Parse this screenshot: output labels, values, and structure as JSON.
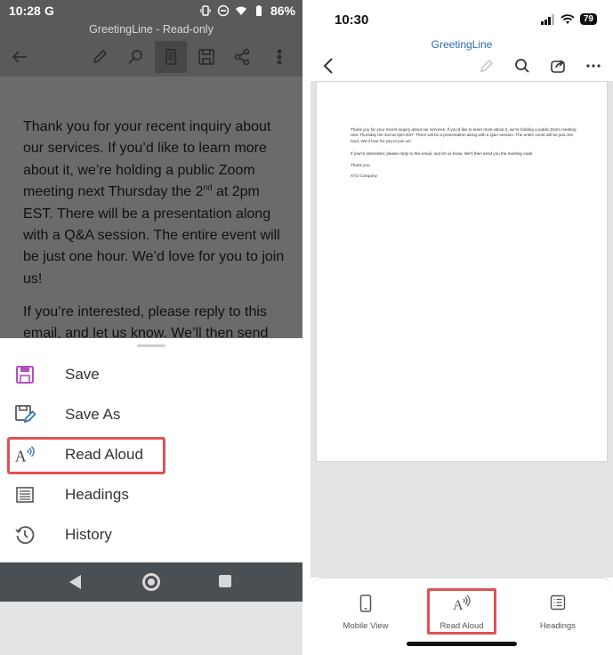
{
  "android": {
    "status": {
      "time": "10:28",
      "g_logo": "G",
      "battery": "86%"
    },
    "title": "GreetingLine - Read-only",
    "toolbar": {
      "icons": [
        "back-arrow-icon",
        "pen-icon",
        "search-icon",
        "reading-view-icon",
        "save-icon",
        "share-icon",
        "more-vert-icon"
      ]
    },
    "document": {
      "para1_a": "Thank you for your recent inquiry about our services. If you’d like to learn more about it, we’re holding a public Zoom meeting next Thursday the 2",
      "para1_sup": "nd",
      "para1_b": " at 2pm EST. There will be a presentation along with a Q&A session. The entire event will be just one hour. We’d love for you to join us!",
      "para2": "If you’re interested, please reply to this email, and let us know. We’ll then send"
    },
    "menu": [
      {
        "label": "Save",
        "icon": "save-icon"
      },
      {
        "label": "Save As",
        "icon": "save-as-icon"
      },
      {
        "label": "Read Aloud",
        "icon": "read-aloud-icon"
      },
      {
        "label": "Headings",
        "icon": "headings-icon"
      },
      {
        "label": "History",
        "icon": "history-icon"
      }
    ],
    "colors": {
      "accent": "#b34fbf",
      "highlight": "#e05252"
    }
  },
  "ios": {
    "status": {
      "time": "10:30",
      "battery": "79"
    },
    "title": "GreetingLine",
    "document": {
      "para1": "Thank you for your recent inquiry about our services. If you’d like to learn more about it, we’re holding a public Zoom meeting next Thursday the 2nd at 2pm EST. There will be a presentation along with a Q&A session. The entire event will be just one hour. We’d love for you to join us!",
      "para2": "If you’re interested, please reply to this email, and let us know. We’ll then send you the meeting code.",
      "closing": "Thank you,",
      "company": "XYZ Company"
    },
    "tabs": [
      {
        "label": "Mobile View",
        "icon": "phone-icon"
      },
      {
        "label": "Read Aloud",
        "icon": "read-aloud-icon"
      },
      {
        "label": "Headings",
        "icon": "headings-icon"
      }
    ],
    "colors": {
      "title": "#2b6cb0",
      "highlight": "#e05252"
    }
  }
}
